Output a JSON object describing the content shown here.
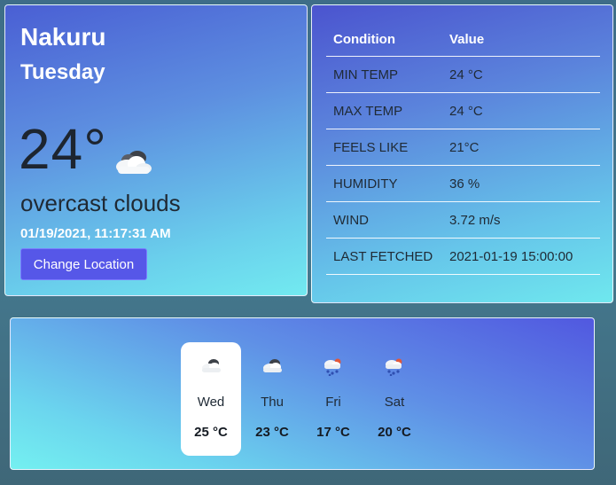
{
  "current": {
    "city": "Nakuru",
    "day": "Tuesday",
    "temperature": "24°",
    "icon": "cloud-icon",
    "description": "overcast clouds",
    "timestamp": "01/19/2021, 11:17:31 AM",
    "change_location_label": "Change Location"
  },
  "details": {
    "headers": [
      "Condition",
      "Value"
    ],
    "rows": [
      {
        "label": "MIN TEMP",
        "value": "24 °C"
      },
      {
        "label": "MAX TEMP",
        "value": "24 °C"
      },
      {
        "label": "FEELS LIKE",
        "value": "21°C"
      },
      {
        "label": "HUMIDITY",
        "value": "36 %"
      },
      {
        "label": "WIND",
        "value": "3.72 m/s"
      },
      {
        "label": "LAST FETCHED",
        "value": "2021-01-19 15:00:00"
      }
    ]
  },
  "forecast": [
    {
      "day": "Wed",
      "temp": "25 °C",
      "icon": "cloud-icon",
      "selected": true
    },
    {
      "day": "Thu",
      "temp": "23 °C",
      "icon": "cloud-icon",
      "selected": false
    },
    {
      "day": "Fri",
      "temp": "17 °C",
      "icon": "rain-icon",
      "selected": false
    },
    {
      "day": "Sat",
      "temp": "20 °C",
      "icon": "rain-icon",
      "selected": false
    }
  ]
}
